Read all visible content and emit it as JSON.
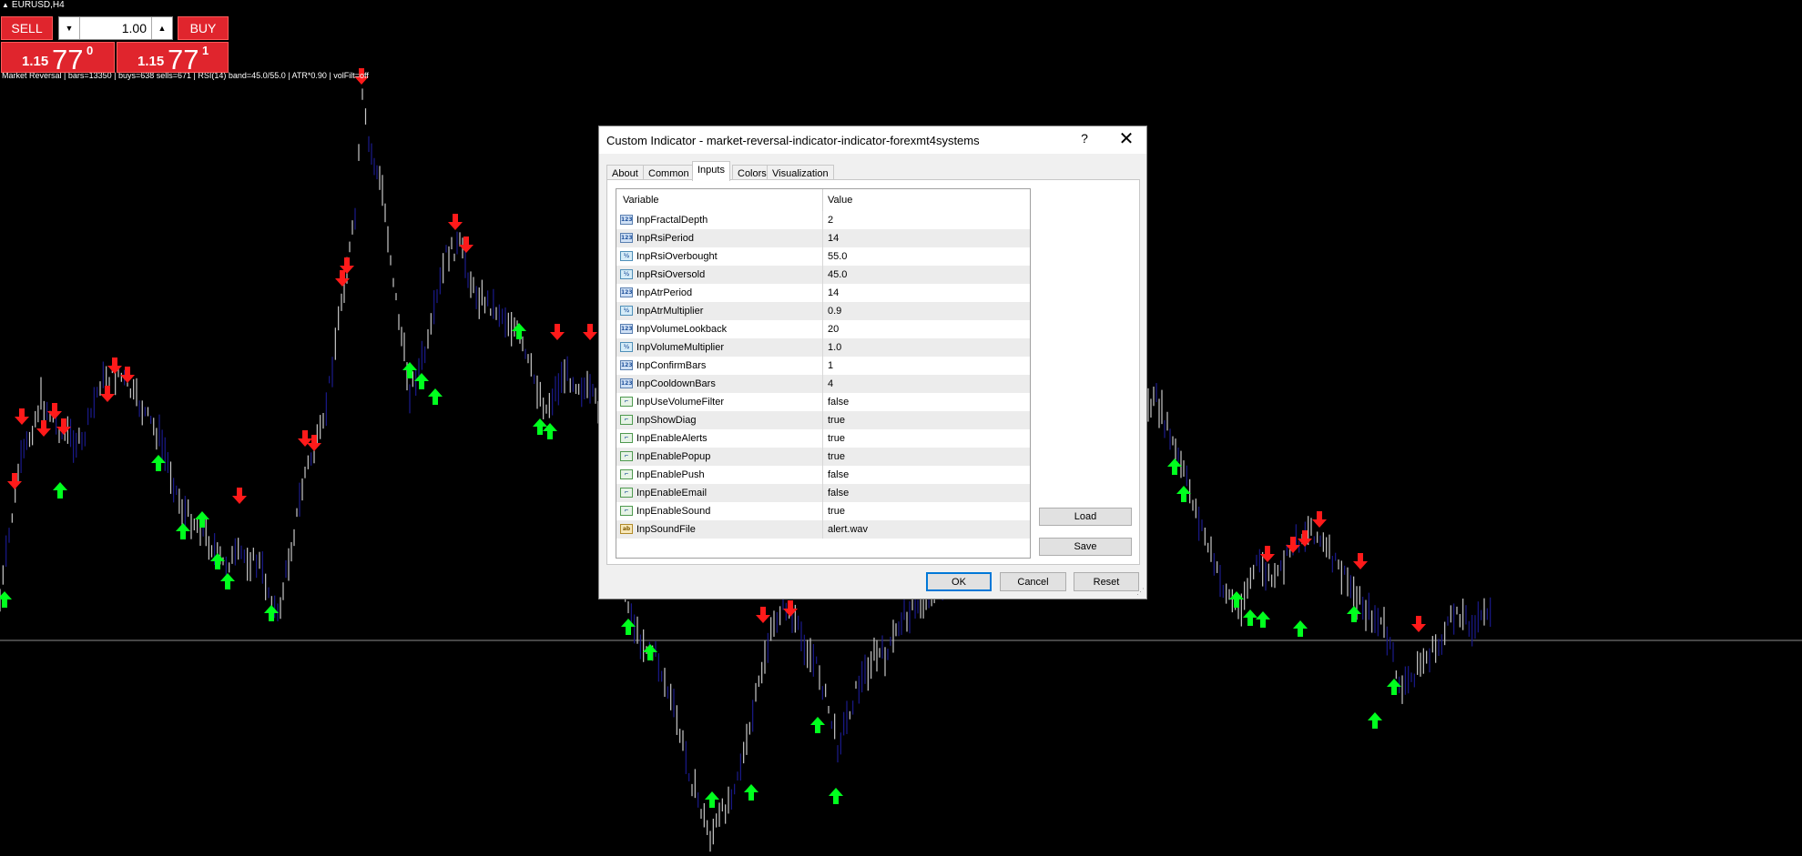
{
  "window": {
    "symbol": "EURUSD,H4"
  },
  "one_click": {
    "sell_label": "SELL",
    "buy_label": "BUY",
    "lot": "1.00",
    "sell_price": {
      "small": "1.15",
      "big": "77",
      "sup": "0"
    },
    "buy_price": {
      "small": "1.15",
      "big": "77",
      "sup": "1"
    },
    "colors": {
      "button": "#e0252d"
    }
  },
  "diag_text": "Market Reversal | bars=13350 | buys=638 sells=671 | RSI(14) band=45.0/55.0 | ATR*0.90 | volFilt=off",
  "dialog": {
    "title": "Custom Indicator - market-reversal-indicator-indicator-forexmt4systems",
    "help_label": "?",
    "close_label": "✕",
    "tabs": [
      {
        "label": "About"
      },
      {
        "label": "Common"
      },
      {
        "label": "Inputs"
      },
      {
        "label": "Colors"
      },
      {
        "label": "Visualization"
      }
    ],
    "active_tab": "Inputs",
    "table": {
      "col_variable": "Variable",
      "col_value": "Value",
      "rows": [
        {
          "icon": "int-icon",
          "name": "InpFractalDepth",
          "value": "2"
        },
        {
          "icon": "int-icon",
          "name": "InpRsiPeriod",
          "value": "14"
        },
        {
          "icon": "double-icon",
          "name": "InpRsiOverbought",
          "value": "55.0"
        },
        {
          "icon": "double-icon",
          "name": "InpRsiOversold",
          "value": "45.0"
        },
        {
          "icon": "int-icon",
          "name": "InpAtrPeriod",
          "value": "14"
        },
        {
          "icon": "double-icon",
          "name": "InpAtrMultiplier",
          "value": "0.9"
        },
        {
          "icon": "int-icon",
          "name": "InpVolumeLookback",
          "value": "20"
        },
        {
          "icon": "double-icon",
          "name": "InpVolumeMultiplier",
          "value": "1.0"
        },
        {
          "icon": "int-icon",
          "name": "InpConfirmBars",
          "value": "1"
        },
        {
          "icon": "int-icon",
          "name": "InpCooldownBars",
          "value": "4"
        },
        {
          "icon": "bool-icon",
          "name": "InpUseVolumeFilter",
          "value": "false"
        },
        {
          "icon": "bool-icon",
          "name": "InpShowDiag",
          "value": "true"
        },
        {
          "icon": "bool-icon",
          "name": "InpEnableAlerts",
          "value": "true"
        },
        {
          "icon": "bool-icon",
          "name": "InpEnablePopup",
          "value": "true"
        },
        {
          "icon": "bool-icon",
          "name": "InpEnablePush",
          "value": "false"
        },
        {
          "icon": "bool-icon",
          "name": "InpEnableEmail",
          "value": "false"
        },
        {
          "icon": "bool-icon",
          "name": "InpEnableSound",
          "value": "true"
        },
        {
          "icon": "string-icon",
          "name": "InpSoundFile",
          "value": "alert.wav"
        }
      ]
    },
    "buttons": {
      "load": "Load",
      "save": "Save",
      "ok": "OK",
      "cancel": "Cancel",
      "reset": "Reset"
    }
  },
  "chart_colors": {
    "background": "#000000",
    "up_bar": "#1a1a8c",
    "down_bar": "#c8c8c8",
    "buy_arrow": "#00ff1e",
    "sell_arrow": "#ff1a1a",
    "grid_line": "#c8c8c8"
  }
}
